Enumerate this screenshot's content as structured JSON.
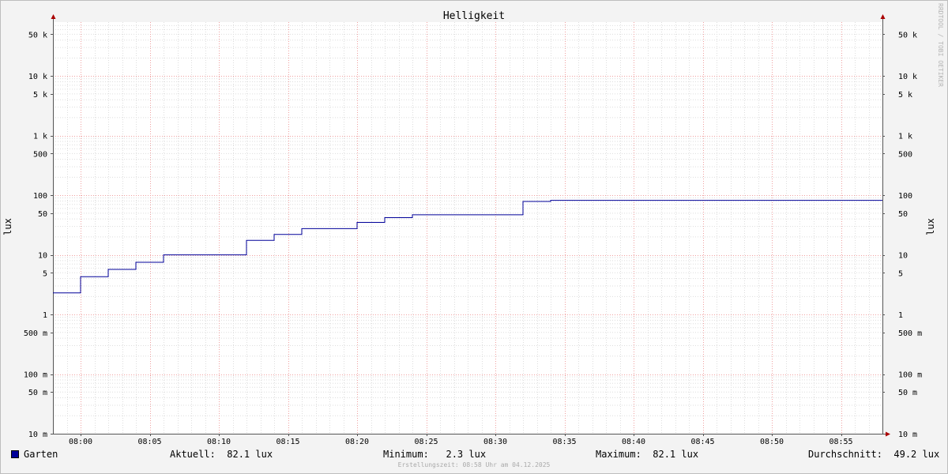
{
  "colors": {
    "series": "#000099",
    "grid_major": "#f0a0a0",
    "grid_minor": "#dddddd",
    "axis": "#555555",
    "arrow": "#aa0000"
  },
  "watermark": "RRDTOOL / TOBI OETIKER",
  "legend": {
    "series_name": "Garten",
    "current": "Aktuell:  82.1 lux",
    "minimum": "Minimum:   2.3 lux",
    "maximum": "Maximum:  82.1 lux",
    "average": "Durchschnitt:  49.2 lux"
  },
  "footer": "Erstellungszeit: 08:58 Uhr am 04.12.2025",
  "chart_data": {
    "type": "line",
    "title": "Helligkeit",
    "ylabel": "lux",
    "ylabel_right": "lux",
    "yscale": "log",
    "ylim": [
      0.01,
      80000
    ],
    "xlim": [
      "07:58",
      "08:58"
    ],
    "y_ticks": [
      {
        "value": 0.01,
        "label": "10 m"
      },
      {
        "value": 0.05,
        "label": "50 m"
      },
      {
        "value": 0.1,
        "label": "100 m"
      },
      {
        "value": 0.5,
        "label": "500 m"
      },
      {
        "value": 1,
        "label": "1"
      },
      {
        "value": 5,
        "label": "5"
      },
      {
        "value": 10,
        "label": "10"
      },
      {
        "value": 50,
        "label": "50"
      },
      {
        "value": 100,
        "label": "100"
      },
      {
        "value": 500,
        "label": "500"
      },
      {
        "value": 1000,
        "label": "1 k"
      },
      {
        "value": 5000,
        "label": "5 k"
      },
      {
        "value": 10000,
        "label": "10 k"
      },
      {
        "value": 50000,
        "label": "50 k"
      }
    ],
    "x_ticks": [
      "08:00",
      "08:05",
      "08:10",
      "08:15",
      "08:20",
      "08:25",
      "08:30",
      "08:35",
      "08:40",
      "08:45",
      "08:50",
      "08:55"
    ],
    "grid": true,
    "series": [
      {
        "name": "Garten",
        "x": [
          "07:58",
          "08:00",
          "08:02",
          "08:04",
          "08:06",
          "08:12",
          "08:14",
          "08:16",
          "08:20",
          "08:22",
          "08:24",
          "08:32",
          "08:34",
          "08:58"
        ],
        "values": [
          2.3,
          4.3,
          5.7,
          7.5,
          10.0,
          17.5,
          22.0,
          27.5,
          35.0,
          42.0,
          47.0,
          78.5,
          82.1,
          82.1
        ]
      }
    ]
  }
}
